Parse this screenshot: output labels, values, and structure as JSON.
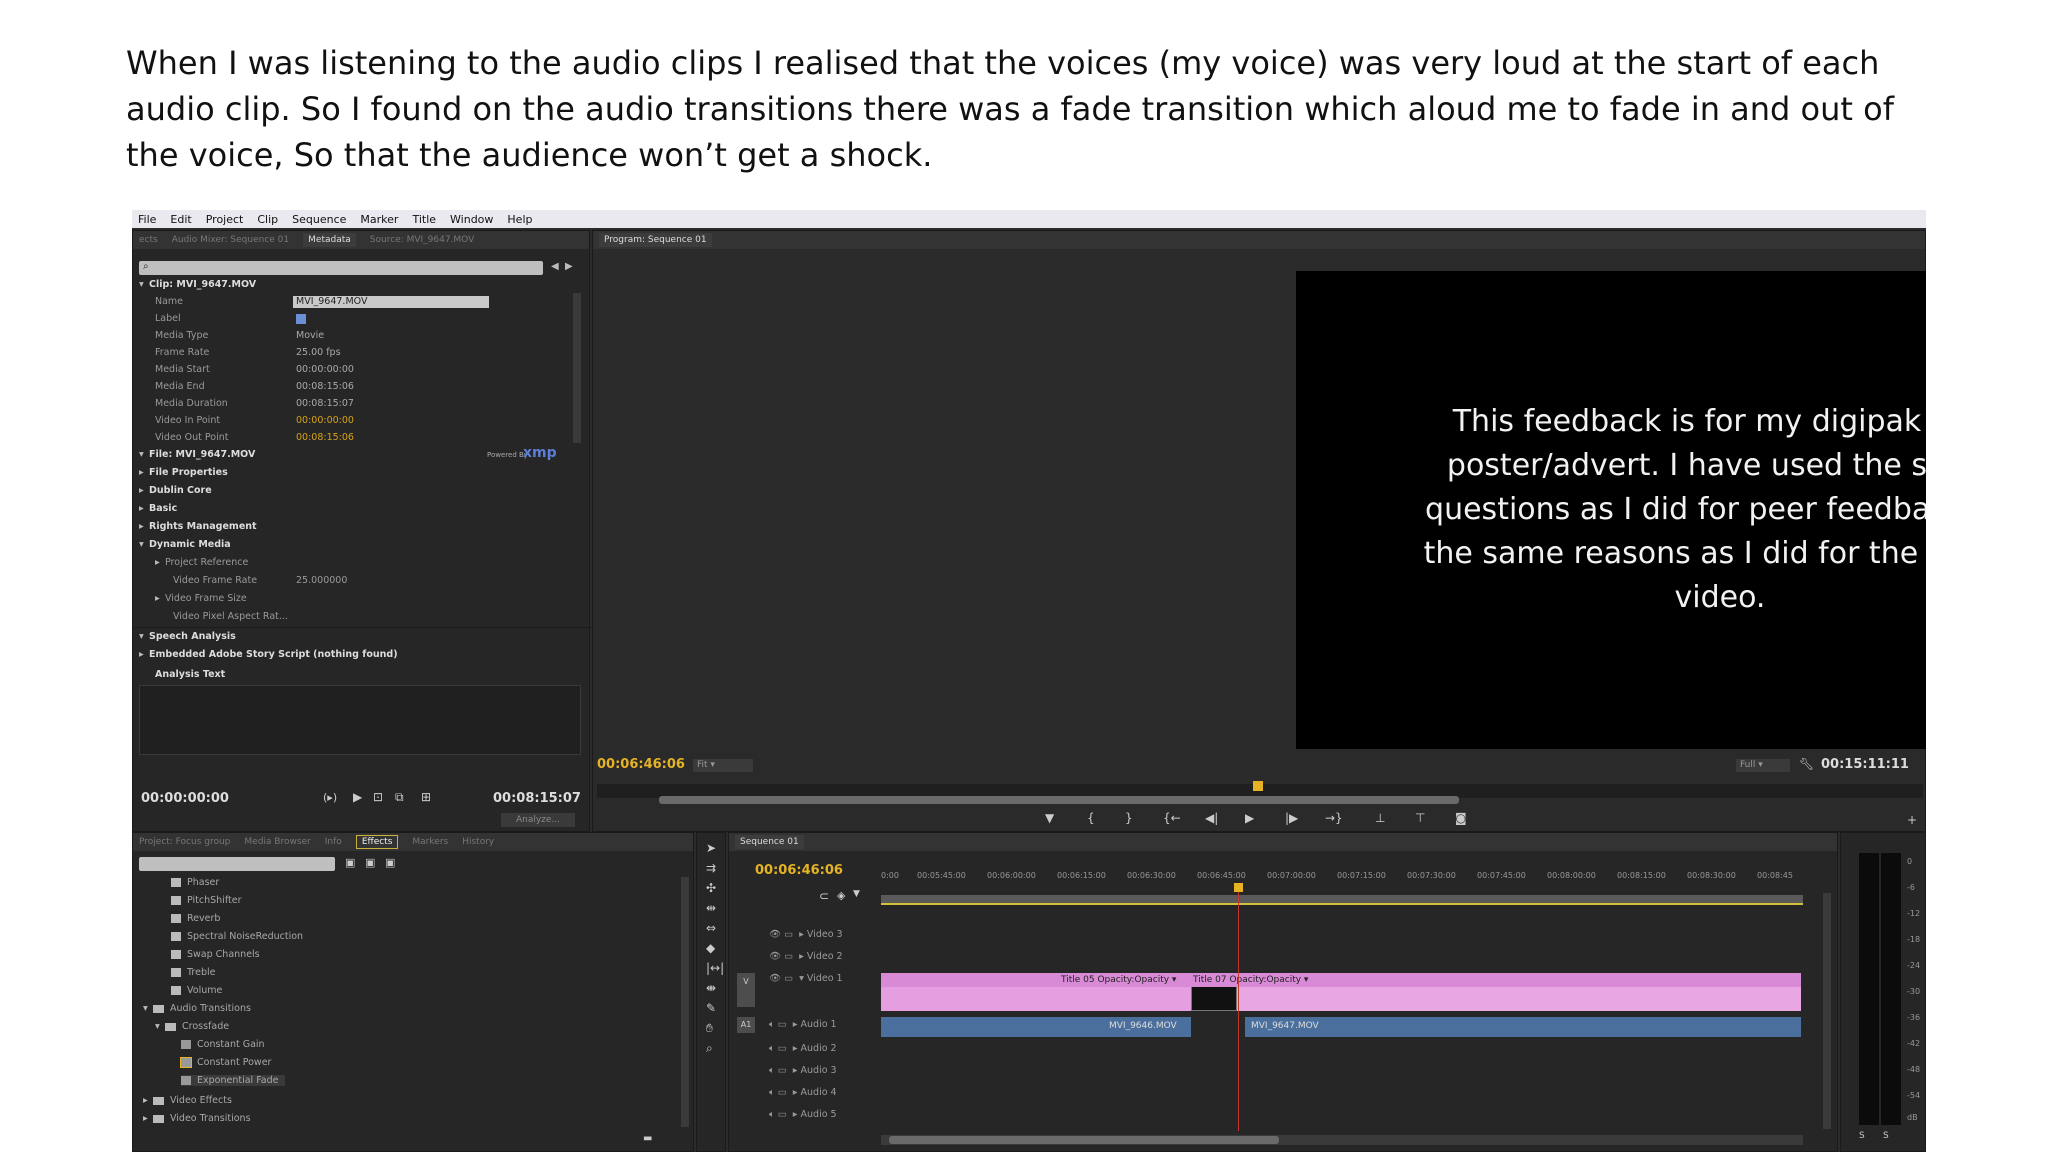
{
  "caption": "When I was listening to the audio clips I realised that the voices (my voice) was very loud at the start of each audio clip. So I found on the audio transitions there was a fade transition which aloud me to fade in and out of the voice, So that the audience won’t get a shock.",
  "menu": [
    "File",
    "Edit",
    "Project",
    "Clip",
    "Sequence",
    "Marker",
    "Title",
    "Window",
    "Help"
  ],
  "source_panel": {
    "tabs": [
      "ects",
      "Audio Mixer: Sequence 01",
      "Metadata",
      "Source: MVI_9647.MOV"
    ],
    "clip_header": "Clip: MVI_9647.MOV",
    "fields": [
      {
        "key": "Name",
        "value": "MVI_9647.MOV"
      },
      {
        "key": "Label",
        "value": ""
      },
      {
        "key": "Media Type",
        "value": "Movie"
      },
      {
        "key": "Frame Rate",
        "value": "25.00 fps"
      },
      {
        "key": "Media Start",
        "value": "00:00:00:00"
      },
      {
        "key": "Media End",
        "value": "00:08:15:06"
      },
      {
        "key": "Media Duration",
        "value": "00:08:15:07"
      },
      {
        "key": "Video In Point",
        "value": "00:00:00:00"
      },
      {
        "key": "Video Out Point",
        "value": "00:08:15:06"
      }
    ],
    "file_header": "File: MVI_9647.MOV",
    "powered_by": "Powered By",
    "xmp": "xmp",
    "sections": [
      "File Properties",
      "Dublin Core",
      "Basic",
      "Rights Management",
      "Dynamic Media"
    ],
    "dynamic_media_items": [
      {
        "label": "Project Reference",
        "value": ""
      },
      {
        "label": "Video Frame Rate",
        "value": "25.000000"
      },
      {
        "label": "Video Frame Size",
        "value": ""
      },
      {
        "label": "Video Pixel Aspect Rat...",
        "value": ""
      }
    ],
    "speech_analysis": "Speech Analysis",
    "embedded_script": "Embedded Adobe Story Script (nothing found)",
    "analysis_text": "Analysis Text",
    "timecode_in": "00:00:00:00",
    "timecode_out": "00:08:15:07",
    "analyze_label": "Analyze..."
  },
  "program_monitor": {
    "tab": "Program: Sequence 01",
    "text": "This feedback is for my digipak and poster/advert. I have used the same questions as I did for peer feedback for the same reasons as I did for the music video.",
    "timecode_current": "00:06:46:06",
    "fit_label": "Fit",
    "zoom_label": "Full",
    "timecode_duration": "00:15:11:11"
  },
  "effects_panel": {
    "tabs": [
      "Project: Focus group",
      "Media Browser",
      "Info",
      "Effects",
      "Markers",
      "History"
    ],
    "items": [
      {
        "label": "Phaser",
        "kind": "effect",
        "indent": 1
      },
      {
        "label": "PitchShifter",
        "kind": "effect",
        "indent": 1
      },
      {
        "label": "Reverb",
        "kind": "effect",
        "indent": 1
      },
      {
        "label": "Spectral NoiseReduction",
        "kind": "effect",
        "indent": 1
      },
      {
        "label": "Swap Channels",
        "kind": "effect",
        "indent": 1
      },
      {
        "label": "Treble",
        "kind": "effect",
        "indent": 1
      },
      {
        "label": "Volume",
        "kind": "effect",
        "indent": 1
      },
      {
        "label": "Audio Transitions",
        "kind": "folder",
        "indent": 0
      },
      {
        "label": "Crossfade",
        "kind": "folder",
        "indent": 1
      },
      {
        "label": "Constant Gain",
        "kind": "transition",
        "indent": 2
      },
      {
        "label": "Constant Power",
        "kind": "transition",
        "indent": 2
      },
      {
        "label": "Exponential Fade",
        "kind": "transition",
        "indent": 2
      },
      {
        "label": "Video Effects",
        "kind": "folder",
        "indent": 0
      },
      {
        "label": "Video Transitions",
        "kind": "folder",
        "indent": 0
      }
    ]
  },
  "timeline": {
    "tab": "Sequence 01",
    "timecode": "00:06:46:06",
    "ruler": [
      "0:00",
      "00:05:45:00",
      "00:06:00:00",
      "00:06:15:00",
      "00:06:30:00",
      "00:06:45:00",
      "00:07:00:00",
      "00:07:15:00",
      "00:07:30:00",
      "00:07:45:00",
      "00:08:00:00",
      "00:08:15:00",
      "00:08:30:00",
      "00:08:45"
    ],
    "tracks": [
      "Video 3",
      "Video 2",
      "Video 1",
      "Audio 1",
      "Audio 2",
      "Audio 3",
      "Audio 4",
      "Audio 5"
    ],
    "track_ids": [
      "V",
      "A1"
    ],
    "video_clip_a_label": "Title 05  Opacity:Opacity ▾",
    "video_clip_b_label": "Title 07  Opacity:Opacity ▾",
    "audio_clip_a": "MVI_9646.MOV",
    "audio_clip_b": "MVI_9647.MOV"
  },
  "meter": {
    "marks": [
      "0",
      "-6",
      "-12",
      "-18",
      "-24",
      "-30",
      "-36",
      "-42",
      "-48",
      "-54",
      "dB"
    ]
  },
  "colors": {
    "video_clip": "#e59ee0",
    "audio_clip": "#4b6f9d",
    "timecode": "#e6b325",
    "playhead": "#c0392b"
  }
}
